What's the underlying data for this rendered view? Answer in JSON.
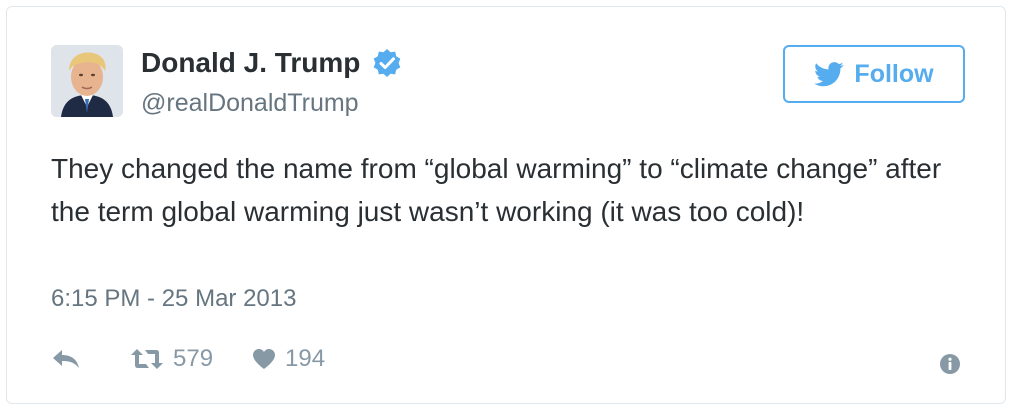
{
  "colors": {
    "brand_blue": "#55acee",
    "text_primary": "#292f33",
    "text_secondary": "#66757f",
    "action_gray": "#8899a6",
    "border": "#e1e8ed"
  },
  "author": {
    "display_name": "Donald J. Trump",
    "handle": "@realDonaldTrump",
    "verified_icon": "verified-badge-icon",
    "avatar_icon": "avatar"
  },
  "follow_button": {
    "label": "Follow",
    "icon": "twitter-bird-icon"
  },
  "tweet": {
    "text": "They changed the name from “global warming” to “climate change” after the term global warming just wasn’t working (it was too cold)!",
    "timestamp": "6:15 PM - 25 Mar 2013"
  },
  "actions": {
    "reply_icon": "reply-icon",
    "retweet_icon": "retweet-icon",
    "retweet_count": "579",
    "like_icon": "heart-icon",
    "like_count": "194",
    "info_icon": "info-icon"
  }
}
